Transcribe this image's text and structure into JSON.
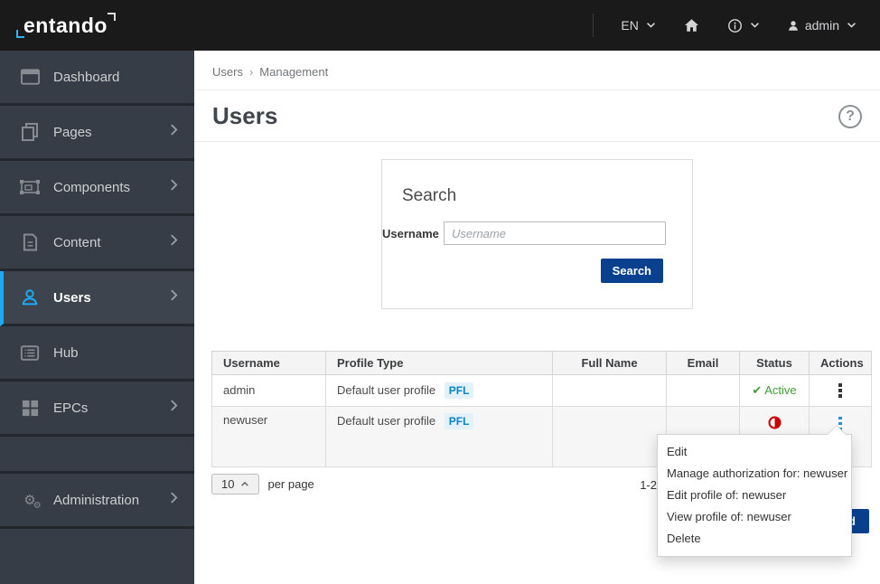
{
  "navbar": {
    "logo_text": "entando",
    "language": "EN",
    "username": "admin"
  },
  "sidebar": {
    "items": [
      {
        "label": "Dashboard"
      },
      {
        "label": "Pages"
      },
      {
        "label": "Components"
      },
      {
        "label": "Content"
      },
      {
        "label": "Users"
      },
      {
        "label": "Hub"
      },
      {
        "label": "EPCs"
      },
      {
        "label": "Administration"
      }
    ]
  },
  "breadcrumb": {
    "section": "Users",
    "separator": "›",
    "page": "Management"
  },
  "page": {
    "title": "Users"
  },
  "icons": {
    "check": "✔",
    "help": "?",
    "gear": "⚙"
  },
  "search_panel": {
    "title": "Search",
    "username_label": "Username",
    "username_placeholder": "Username",
    "search_button_label": "Search"
  },
  "table": {
    "headers": [
      "Username",
      "Profile Type",
      "Full Name",
      "Email",
      "Status",
      "Actions"
    ],
    "rows": [
      {
        "username": "admin",
        "profile_type": "Default user profile",
        "profile_badge": "PFL",
        "full_name": "",
        "email": "",
        "status": "Active"
      },
      {
        "username": "newuser",
        "profile_type": "Default user profile",
        "profile_badge": "PFL",
        "full_name": "",
        "email": "",
        "status": "Expired"
      }
    ]
  },
  "pagination": {
    "page_size": "10",
    "per_page_label": "per page",
    "range": "1-2"
  },
  "context_menu": {
    "items": [
      "Edit",
      "Manage authorization for: newuser",
      "Edit profile of: newuser",
      "View profile of: newuser",
      "Delete"
    ]
  },
  "footer": {
    "add_label": "Add"
  },
  "colors": {
    "accent_blue": "#1caaf5",
    "primary_navy": "#09418f",
    "active_green": "#3f9c35",
    "expired_red": "#cc0000",
    "badge_text": "#0a85c0",
    "badge_bg": "#e3f1fa"
  }
}
